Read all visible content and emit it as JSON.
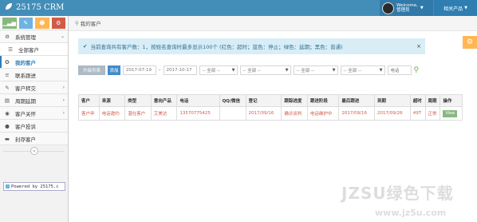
{
  "app": {
    "brand_name": "25175 CRM",
    "welcome": "Welcome,",
    "username": "管理员",
    "products_menu": "相关产品"
  },
  "sidebar": {
    "items": [
      {
        "label": "系统管理",
        "icon": "gear-icon",
        "glyph": "⚙",
        "arrow": "⌄",
        "type": "parent"
      },
      {
        "label": "全部客户",
        "icon": "list-icon",
        "glyph": "☰",
        "type": "item"
      },
      {
        "label": "我的客户",
        "icon": "lightbulb-icon",
        "glyph": "✪",
        "type": "active"
      },
      {
        "label": "联系跟进",
        "icon": "list-icon",
        "glyph": "≡",
        "type": "item"
      },
      {
        "label": "客户转交",
        "icon": "pencil-icon",
        "glyph": "✎",
        "arrow": "›",
        "type": "parent"
      },
      {
        "label": "周期延期",
        "icon": "calendar-icon",
        "glyph": "▤",
        "arrow": "›",
        "type": "parent"
      },
      {
        "label": "客户关怀",
        "icon": "eye-icon",
        "glyph": "◉",
        "arrow": "›",
        "type": "parent"
      },
      {
        "label": "客户投诉",
        "icon": "comment-icon",
        "glyph": "●",
        "type": "item"
      },
      {
        "label": "封存客户",
        "icon": "folder-icon",
        "glyph": "▬",
        "type": "item"
      }
    ],
    "collapse_glyph": "«",
    "powered_by": "Powered by 25175.c"
  },
  "breadcrumb": {
    "text": "我的客户"
  },
  "alert": {
    "text": "当前查询共有客户数：1，按姓名查询时最多显示100个 (红色：超时；蓝色：停止；绿色：延期；黑色：普通)",
    "close": "×"
  },
  "toolbar": {
    "open_list": "升级列表",
    "add": "添加",
    "date_from": "2017-07-19",
    "date_to": "2017-10-17",
    "select1": "-- 全部 --",
    "select2": "-- 全部 --",
    "select3": "-- 全部 --",
    "select4": "-- 全部 --",
    "phone_placeholder": "电话"
  },
  "table": {
    "headers": [
      "客户",
      "来源",
      "类型",
      "意向产品",
      "电话",
      "QQ/微信",
      "登记",
      "跟踪进度",
      "跟进阶段",
      "最后跟进",
      "到期",
      "超时",
      "周期",
      "操作"
    ],
    "rows": [
      [
        "客户甲",
        "电话邀约",
        "潜在客户",
        "艾美达",
        "13570775425",
        "",
        "2017/09/16",
        "确诊谈判",
        "电话维护中",
        "2017/09/16",
        "2017/09/26",
        "49T",
        "正常",
        "View"
      ]
    ]
  },
  "watermark": {
    "top": "JZSU绿色下载",
    "bottom": "www.jz5u.com"
  },
  "colors": {
    "header": "#438eb9",
    "overtime": "#d15b47",
    "active": "#2b7dbc"
  }
}
